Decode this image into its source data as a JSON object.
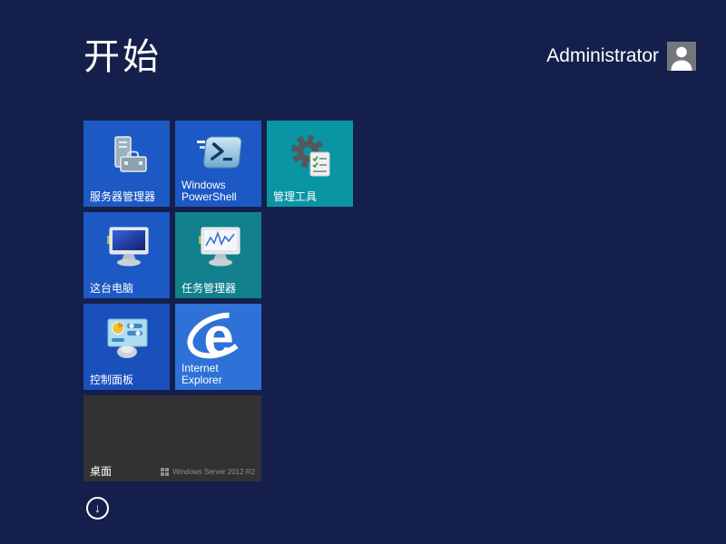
{
  "header": {
    "title": "开始",
    "username": "Administrator"
  },
  "colors": {
    "background": "#14204b",
    "tile_blue": "#1d59c4",
    "tile_teal": "#0a95a4",
    "tile_teal_dark": "#12818d",
    "tile_blue_dark": "#1a50bc",
    "tile_blue_light": "#2e72d8",
    "tile_desktop_gray": "#333134",
    "text": "#ffffff",
    "watermark_text": "#8e8e8e"
  },
  "tiles": [
    {
      "id": "server-manager",
      "label": "服务器管理器",
      "color": "#1d59c4",
      "icon": "server-manager-icon"
    },
    {
      "id": "windows-powershell",
      "label": "Windows PowerShell",
      "color": "#1d59c4",
      "icon": "powershell-icon"
    },
    {
      "id": "admin-tools",
      "label": "管理工具",
      "color": "#0a95a4",
      "icon": "gear-checklist-icon"
    },
    {
      "id": "this-pc",
      "label": "这台电脑",
      "color": "#1d59c4",
      "icon": "computer-icon"
    },
    {
      "id": "task-manager",
      "label": "任务管理器",
      "color": "#12818d",
      "icon": "performance-monitor-icon"
    },
    {
      "id": "control-panel",
      "label": "控制面板",
      "color": "#1a50bc",
      "icon": "control-panel-icon"
    },
    {
      "id": "internet-explorer",
      "label": "Internet Explorer",
      "color": "#2e72d8",
      "icon": "ie-logo-icon"
    },
    {
      "id": "desktop",
      "label": "桌面",
      "color": "#333134",
      "icon": "none",
      "watermark": "Windows Server 2012 R2"
    }
  ],
  "footer": {
    "expand_arrow": "↓"
  }
}
